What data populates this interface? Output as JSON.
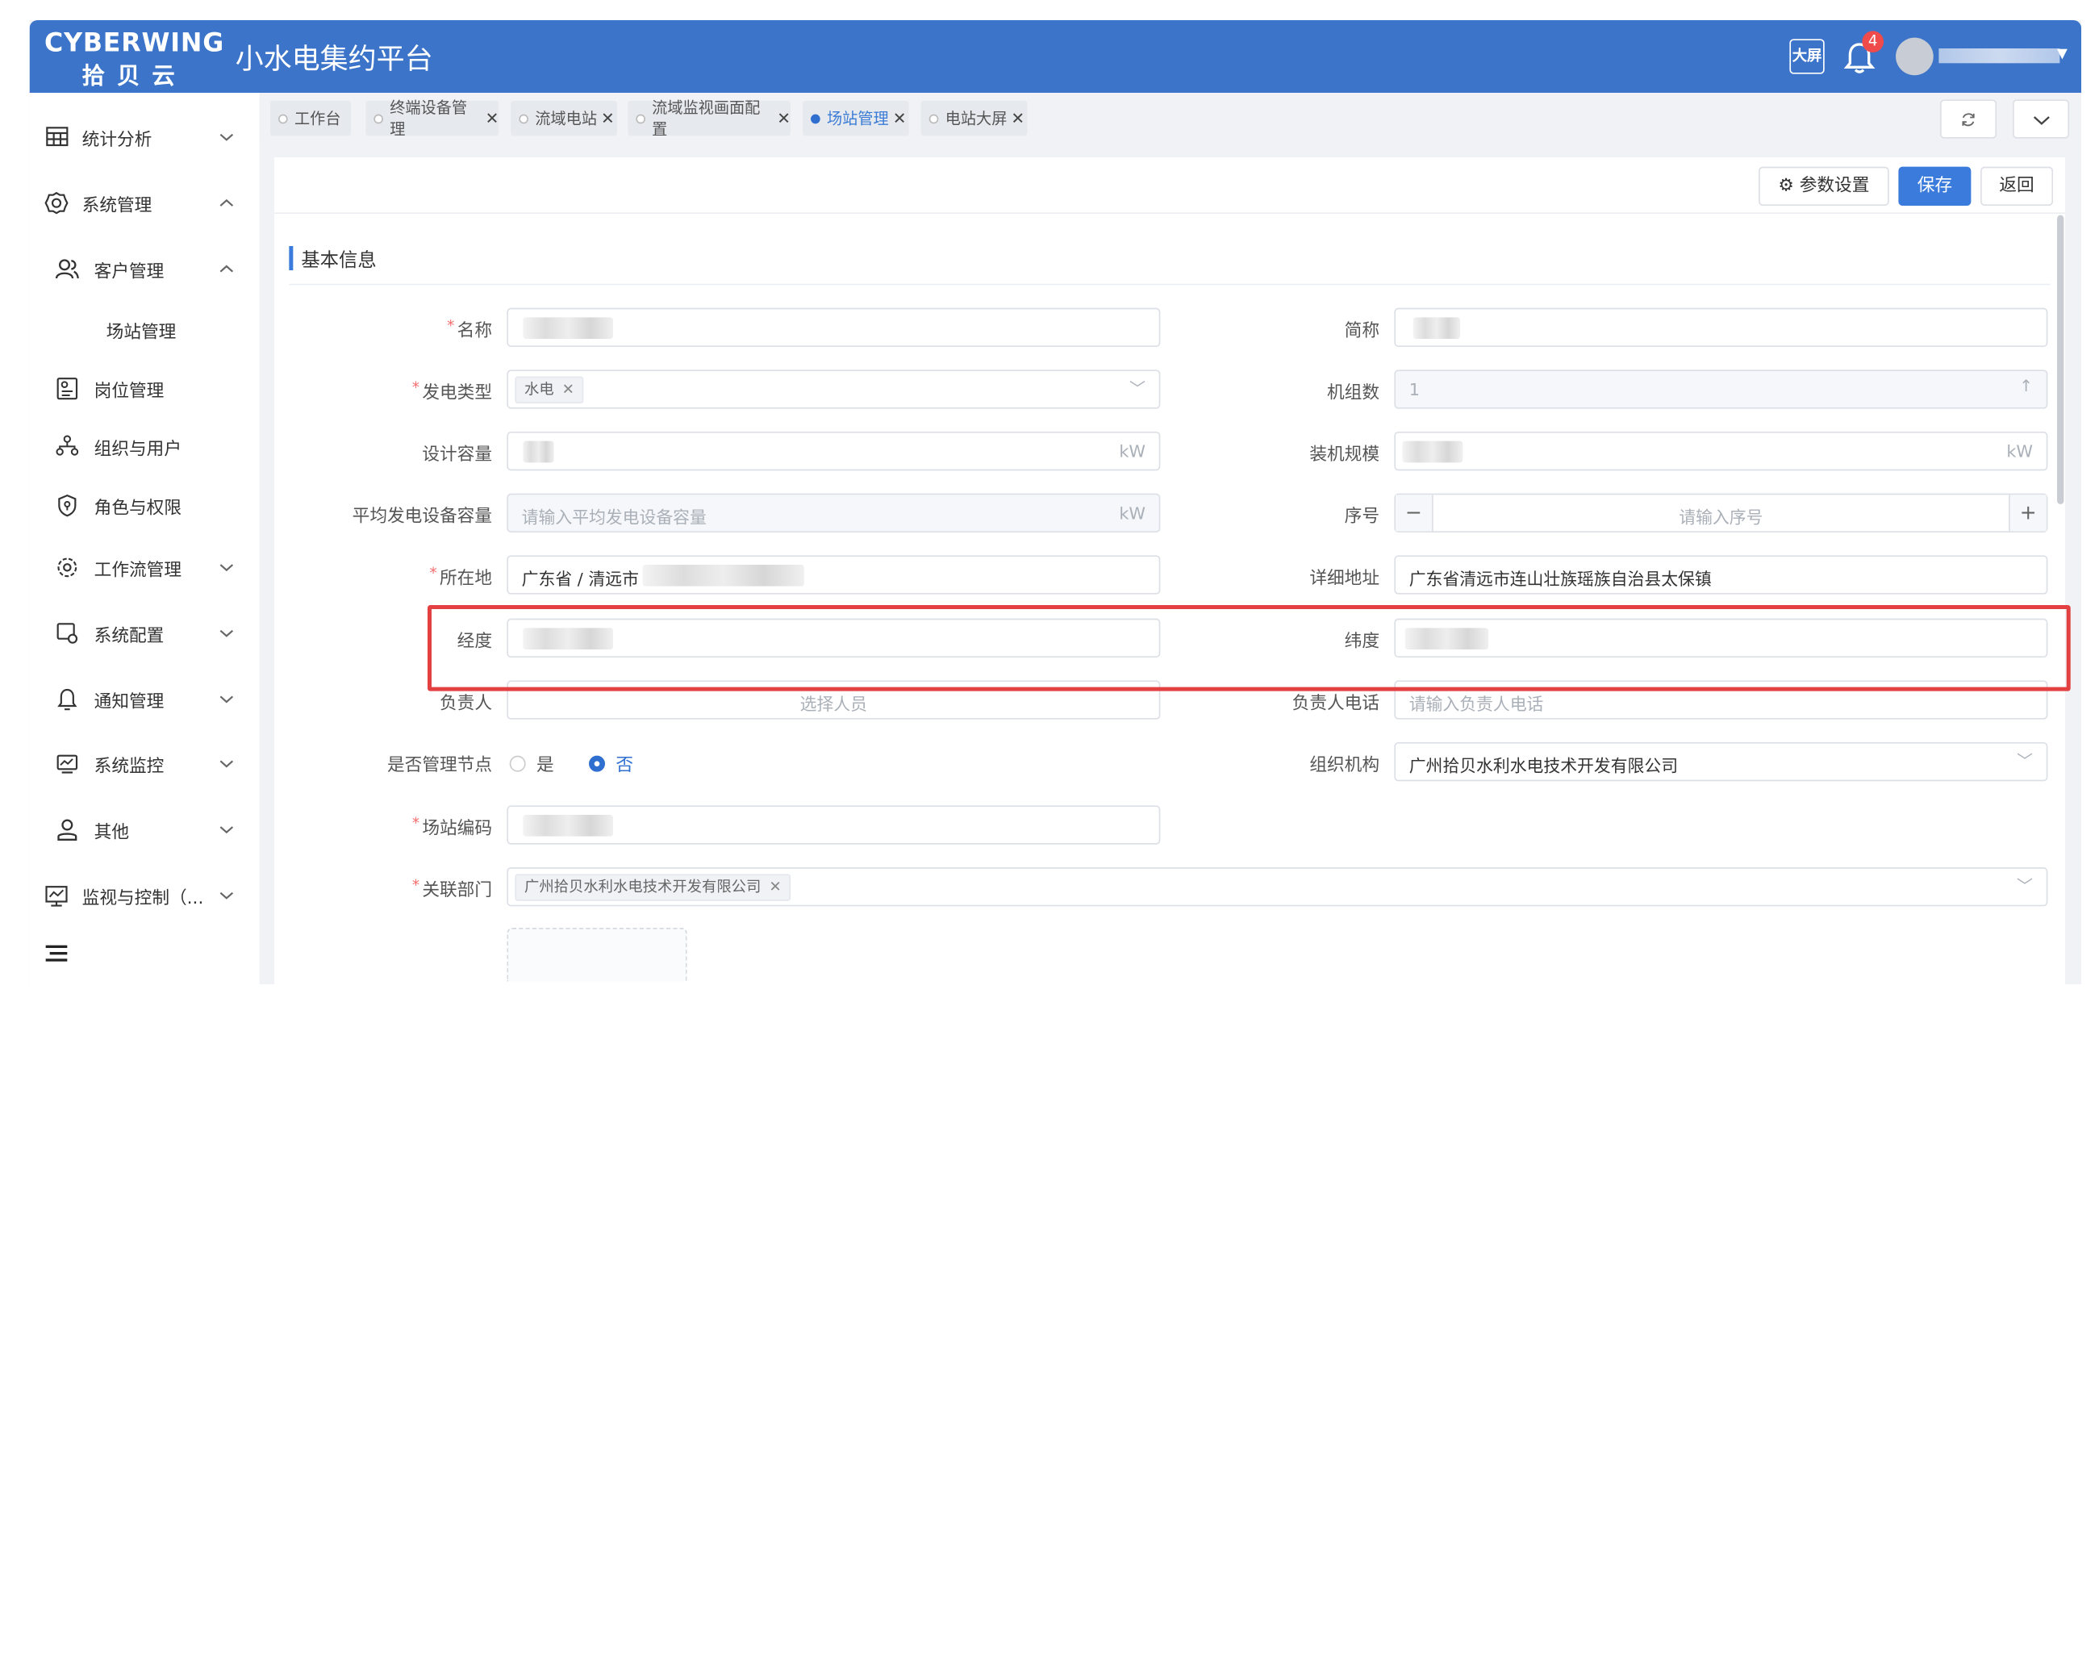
{
  "header": {
    "logo_en": "CYBERWING",
    "logo_cn": "拾贝云",
    "app_title": "小水电集约平台",
    "bigscreen_label": "大屏",
    "notify_count": "4"
  },
  "sidebar": {
    "items": [
      {
        "label": "统计分析",
        "icon": "table-chart-icon",
        "chev": "⌄"
      },
      {
        "label": "系统管理",
        "icon": "gear-icon",
        "chev": "⌃"
      },
      {
        "label": "客户管理",
        "icon": "users-icon",
        "chev": "⌃"
      },
      {
        "label": "场站管理"
      },
      {
        "label": "岗位管理",
        "icon": "post-icon"
      },
      {
        "label": "组织与用户",
        "icon": "org-icon"
      },
      {
        "label": "角色与权限",
        "icon": "shield-icon"
      },
      {
        "label": "工作流管理",
        "icon": "workflow-icon",
        "chev": "⌄"
      },
      {
        "label": "系统配置",
        "icon": "config-icon",
        "chev": "⌄"
      },
      {
        "label": "通知管理",
        "icon": "bell-icon",
        "chev": "⌄"
      },
      {
        "label": "系统监控",
        "icon": "monitor-icon",
        "chev": "⌄"
      },
      {
        "label": "其他",
        "icon": "person-icon",
        "chev": "⌄"
      },
      {
        "label": "监视与控制（...",
        "icon": "chart-monitor-icon",
        "chev": "⌄"
      }
    ]
  },
  "tabs": [
    {
      "label": "工作台",
      "closable": false,
      "active": false
    },
    {
      "label": "终端设备管理",
      "closable": true,
      "active": false
    },
    {
      "label": "流域电站",
      "closable": true,
      "active": false
    },
    {
      "label": "流域监视画面配置",
      "closable": true,
      "active": false
    },
    {
      "label": "场站管理",
      "closable": true,
      "active": true
    },
    {
      "label": "电站大屏",
      "closable": true,
      "active": false
    }
  ],
  "toolbar": {
    "params_label": "参数设置",
    "save_label": "保存",
    "back_label": "返回"
  },
  "section": {
    "title": "基本信息"
  },
  "form": {
    "name_label": "名称",
    "short_label": "简称",
    "gen_type_label": "发电类型",
    "gen_type_tag": "水电",
    "units_label": "机组数",
    "units_value": "1",
    "capacity_label": "设计容量",
    "capacity_unit": "kW",
    "install_label": "装机规模",
    "install_unit": "kW",
    "avg_label": "平均发电设备容量",
    "avg_placeholder": "请输入平均发电设备容量",
    "avg_unit": "kW",
    "seq_label": "序号",
    "seq_placeholder": "请输入序号",
    "location_label": "所在地",
    "location_value": "广东省 / 清远市",
    "address_label": "详细地址",
    "address_value": "广东省清远市连山壮族瑶族自治县太保镇",
    "lng_label": "经度",
    "lat_label": "纬度",
    "owner_label": "负责人",
    "owner_placeholder": "选择人员",
    "phone_label": "负责人电话",
    "phone_placeholder": "请输入负责人电话",
    "mgmt_label": "是否管理节点",
    "mgmt_yes": "是",
    "mgmt_no": "否",
    "org_label": "组织机构",
    "org_value": "广州拾贝水利水电技术开发有限公司",
    "code_label": "场站编码",
    "dept_label": "关联部门",
    "dept_tag": "广州拾贝水利水电技术开发有限公司"
  }
}
